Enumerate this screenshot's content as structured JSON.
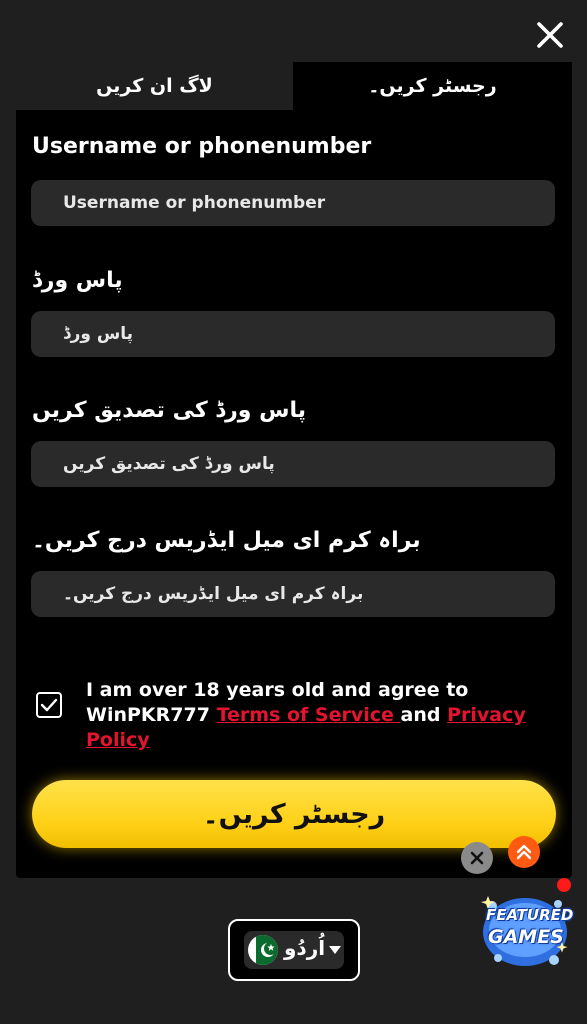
{
  "close_label": "×",
  "tabs": {
    "login": "لاگ ان کریں",
    "register": "رجسٹر کریں۔"
  },
  "form": {
    "username": {
      "label": "Username or phonenumber",
      "placeholder": "Username or phonenumber"
    },
    "password": {
      "label": "پاس ورڈ",
      "placeholder": "پاس ورڈ"
    },
    "confirm_password": {
      "label": "پاس ورڈ کی تصدیق کریں",
      "placeholder": "پاس ورڈ کی تصدیق کریں"
    },
    "email": {
      "label": "براہ کرم ای میل ایڈریس درج کریں۔",
      "placeholder": "براہ کرم ای میل ایڈریس درج کریں۔"
    }
  },
  "agreement": {
    "checked": true,
    "text_1": "I am over 18 years old and agree to WinPKR777 ",
    "terms_link": "Terms of Service ",
    "text_2": "and ",
    "privacy_link": "Privacy Policy"
  },
  "submit_label": "رجسٹر کریں۔",
  "featured": {
    "line1": "FEATURED",
    "line2": "GAMES"
  },
  "language": {
    "selected": "اُردُو",
    "flag": "pakistan-flag-icon"
  },
  "colors": {
    "accent_yellow": "#ffd21a",
    "link_red": "#e4132f",
    "scroll_orange": "#ff5a12",
    "background": "#1f1f1f",
    "panel": "#000000"
  }
}
